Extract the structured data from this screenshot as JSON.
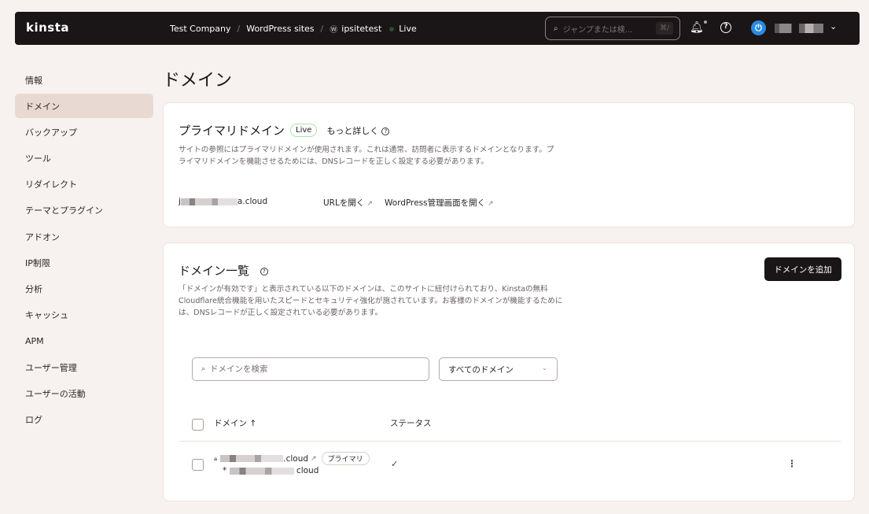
{
  "topbar": {
    "logo": "kinsta",
    "breadcrumbs": [
      "Test Company",
      "WordPress sites",
      "ipsitetest",
      "Live"
    ],
    "breadcrumb_separator": "/",
    "search_placeholder": "ジャンプまたは検...",
    "search_shortcut": "⌘/",
    "icons": {
      "search": "search-icon",
      "notifications": "bell-icon",
      "help": "help-icon",
      "avatar": "power-icon",
      "account_menu": "chevron-down-icon"
    }
  },
  "sidebar": {
    "items": [
      {
        "label": "情報",
        "active": false
      },
      {
        "label": "ドメイン",
        "active": true
      },
      {
        "label": "バックアップ",
        "active": false
      },
      {
        "label": "ツール",
        "active": false
      },
      {
        "label": "リダイレクト",
        "active": false
      },
      {
        "label": "テーマとプラグイン",
        "active": false
      },
      {
        "label": "アドオン",
        "active": false
      },
      {
        "label": "IP制限",
        "active": false
      },
      {
        "label": "分析",
        "active": false
      },
      {
        "label": "キャッシュ",
        "active": false
      },
      {
        "label": "APM",
        "active": false
      },
      {
        "label": "ユーザー管理",
        "active": false
      },
      {
        "label": "ユーザーの活動",
        "active": false
      },
      {
        "label": "ログ",
        "active": false
      }
    ]
  },
  "page": {
    "title": "ドメイン"
  },
  "primary_domain": {
    "title": "プライマリドメイン",
    "badge": "Live",
    "learn_more": "もっと詳しく",
    "description": "サイトの参照にはプライマリドメインが使用されます。これは通常、訪問者に表示するドメインとなります。プライマリドメインを機能させるためには、DNSレコードを正しく設定する必要があります。",
    "domain_prefix": "j",
    "domain_suffix": "a.cloud",
    "open_url": "URLを開く",
    "open_wp_admin": "WordPress管理画面を開く"
  },
  "domain_list": {
    "title": "ドメイン一覧",
    "add_button": "ドメインを追加",
    "description": "「ドメインが有効です」と表示されている以下のドメインは、このサイトに紐付けられており、Kinstaの無料Cloudflare統合機能を用いたスピードとセキュリティ強化が施されています。お客様のドメインが機能するためには、DNSレコードが正しく設定されている必要があります。",
    "search_placeholder": "ドメインを検索",
    "filter_value": "すべてのドメイン",
    "columns": {
      "domain": "ドメイン ↑",
      "status": "ステータス"
    },
    "rows": [
      {
        "domain_suffix": ".cloud",
        "wildcard_prefix": "*",
        "wildcard_suffix": "cloud",
        "badge": "プライマリ",
        "status": "✓",
        "actions": "⋮"
      }
    ]
  },
  "colors": {
    "topbar_bg": "#1a1516",
    "page_bg": "#f7f2ef",
    "active_nav": "#e8dad2",
    "live_badge_border": "#a9e7a9",
    "avatar": "#2a8be0"
  }
}
